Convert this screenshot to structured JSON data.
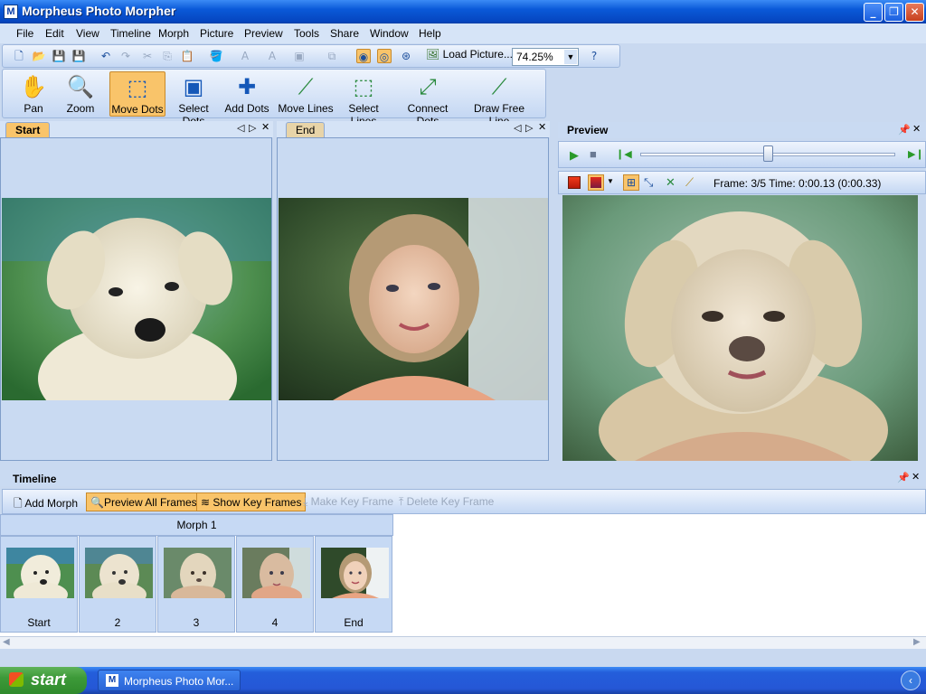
{
  "window": {
    "title": "Morpheus Photo Morpher",
    "app_icon": "M"
  },
  "menu": [
    "File",
    "Edit",
    "View",
    "Timeline",
    "Morph",
    "Picture",
    "Preview",
    "Tools",
    "Share",
    "Window",
    "Help"
  ],
  "toolbar": {
    "load_picture": "Load Picture...",
    "zoom": "74.25%"
  },
  "tools": [
    {
      "label": "Pan",
      "icon": "hand-icon"
    },
    {
      "label": "Zoom",
      "icon": "magnifier-icon"
    },
    {
      "label": "Move Dots",
      "icon": "move-dots-icon"
    },
    {
      "label": "Select Dots",
      "icon": "select-dots-icon"
    },
    {
      "label": "Add Dots",
      "icon": "add-dots-icon"
    },
    {
      "label": "Move Lines",
      "icon": "move-lines-icon"
    },
    {
      "label": "Select Lines",
      "icon": "select-lines-icon"
    },
    {
      "label": "Connect Dots",
      "icon": "connect-dots-icon"
    },
    {
      "label": "Draw Free Line",
      "icon": "draw-line-icon"
    }
  ],
  "start_panel": {
    "tab": "Start"
  },
  "end_panel": {
    "tab": "End"
  },
  "preview": {
    "title": "Preview",
    "status": "Frame: 3/5 Time: 0:00.13 (0:00.33)",
    "slider_position": 0.5
  },
  "timeline": {
    "title": "Timeline",
    "buttons": {
      "add_morph": "Add Morph",
      "preview_all": "Preview All Frames",
      "show_key": "Show Key Frames",
      "make_key": "Make Key Frame",
      "delete_key": "Delete Key Frame"
    },
    "morph_label": "Morph 1",
    "frames": [
      "Start",
      "2",
      "3",
      "4",
      "End"
    ]
  },
  "taskbar": {
    "start": "start",
    "task": "Morpheus Photo Mor..."
  },
  "colors": {
    "accent": "#f9c46a",
    "title_blue": "#0a59d8",
    "panel_bg": "#c9daf2"
  }
}
